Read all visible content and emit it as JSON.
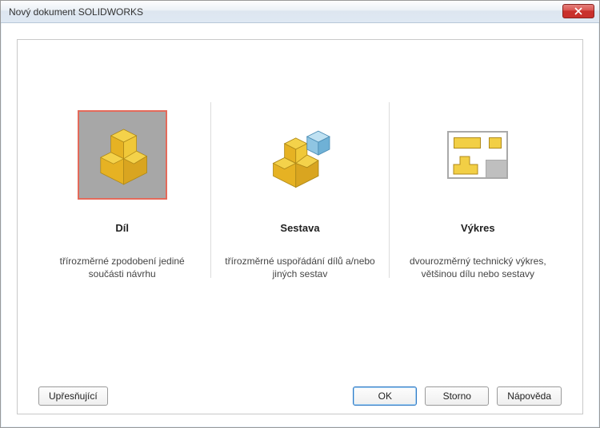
{
  "title": "Nový dokument SOLIDWORKS",
  "options": [
    {
      "label": "Díl",
      "desc": "třírozměrné zpodobení jediné součásti návrhu",
      "selected": true
    },
    {
      "label": "Sestava",
      "desc": "třírozměrné uspořádání dílů a/nebo jiných sestav",
      "selected": false
    },
    {
      "label": "Výkres",
      "desc": "dvourozměrný technický výkres, většinou dílu nebo sestavy",
      "selected": false
    }
  ],
  "buttons": {
    "advanced": "Upřesňující",
    "ok": "OK",
    "cancel": "Storno",
    "help": "Nápověda"
  }
}
